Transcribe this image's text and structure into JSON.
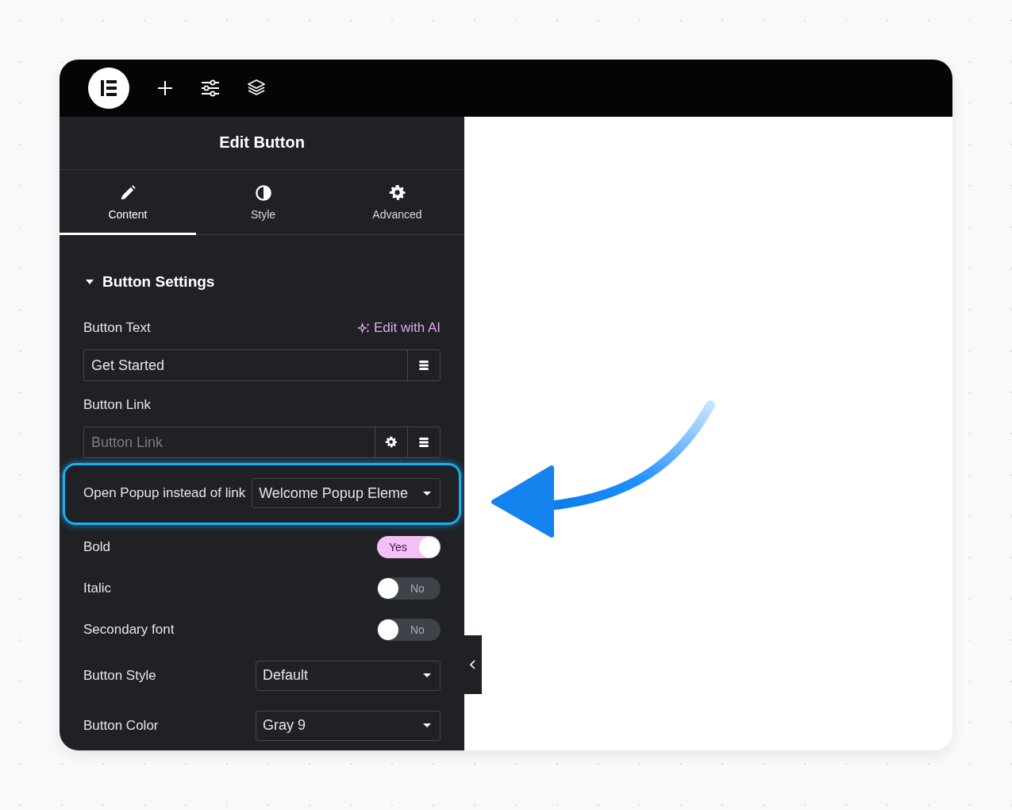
{
  "panel": {
    "title": "Edit Button"
  },
  "tabs": [
    {
      "label": "Content",
      "kind": "content",
      "selected": true
    },
    {
      "label": "Style",
      "kind": "style",
      "selected": false
    },
    {
      "label": "Advanced",
      "kind": "advanced",
      "selected": false
    }
  ],
  "section": {
    "title": "Button Settings",
    "expanded": true
  },
  "controls": [
    {
      "kind": "text",
      "label": "Button Text",
      "action": "Edit with AI",
      "value": "Get Started"
    },
    {
      "kind": "url",
      "label": "Button Link",
      "placeholder": "Button Link"
    },
    {
      "kind": "select",
      "label": "Open Popup instead of link",
      "value": "Welcome Popup Eleme",
      "highlighted": true
    },
    {
      "kind": "switch",
      "label": "Bold",
      "on": true,
      "text": "Yes"
    },
    {
      "kind": "switch",
      "label": "Italic",
      "on": false,
      "text": "No"
    },
    {
      "kind": "switch",
      "label": "Secondary font",
      "on": false,
      "text": "No"
    },
    {
      "kind": "select",
      "label": "Button Style",
      "value": "Default",
      "highlighted": false
    },
    {
      "kind": "select",
      "label": "Button Color",
      "value": "Gray 9",
      "highlighted": false
    }
  ]
}
